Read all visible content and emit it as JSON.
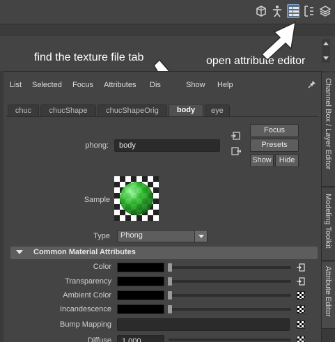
{
  "annotations": {
    "left": "find the texture file tab",
    "right": "open attribute editor"
  },
  "toolbar_icons": [
    "modeling-toolkit-icon",
    "character-icon",
    "attribute-editor-icon",
    "tool-settings-icon",
    "channel-box-icon"
  ],
  "menu": [
    "List",
    "Selected",
    "Focus",
    "Attributes",
    "Display",
    "Show",
    "Help"
  ],
  "menu_visible": {
    "list": "List",
    "selected": "Selected",
    "focus": "Focus",
    "attributes": "Attributes",
    "display": "Dis",
    "show": "Show",
    "help": "Help"
  },
  "tabs": [
    "chuc",
    "chucShape",
    "chucShapeOrig",
    "body",
    "eye"
  ],
  "active_tab": "body",
  "node": {
    "type_label": "phong:",
    "name": "body",
    "buttons": {
      "focus": "Focus",
      "presets": "Presets",
      "show": "Show",
      "hide": "Hide"
    }
  },
  "sample_label": "Sample",
  "type": {
    "label": "Type",
    "value": "Phong"
  },
  "section": {
    "title": "Common Material Attributes"
  },
  "attributes": [
    {
      "label": "Color",
      "swatch": "#000000",
      "slider": 0.0
    },
    {
      "label": "Transparency",
      "swatch": "#000000",
      "slider": 0.0
    },
    {
      "label": "Ambient Color",
      "swatch": "#000000",
      "slider": 0.0
    },
    {
      "label": "Incandescence",
      "swatch": "#000000",
      "slider": 0.0
    },
    {
      "label": "Bump Mapping",
      "swatch": null,
      "slider": null
    },
    {
      "label": "Diffuse",
      "value": "1.000",
      "slider": 1.0
    }
  ],
  "side_tabs": [
    "Channel Box / Layer Editor",
    "Modeling Toolkit",
    "Attribute Editor"
  ],
  "colors": {
    "background": "#444444",
    "field": "#2b2b2b",
    "button": "#5d5d5d",
    "accent_blue": "#7aa6d8",
    "sample_green": "#2ebd2e"
  }
}
